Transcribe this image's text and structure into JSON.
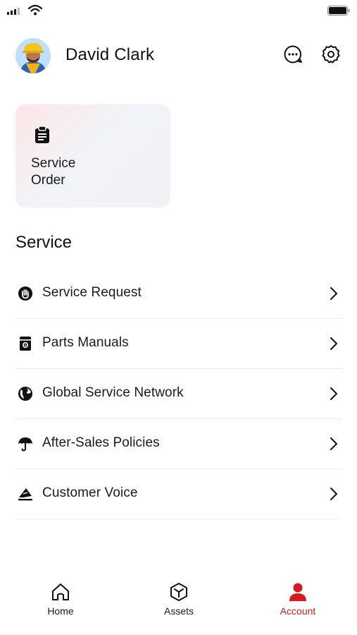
{
  "user": {
    "name": "David Clark"
  },
  "header": {
    "chat_icon": "chat-bubble-icon",
    "settings_icon": "gear-icon"
  },
  "service_order_card": {
    "label": "Service\nOrder",
    "icon": "clipboard-icon"
  },
  "section": {
    "title": "Service"
  },
  "menu": [
    {
      "label": "Service Request",
      "icon": "hand-icon"
    },
    {
      "label": "Parts Manuals",
      "icon": "manual-icon"
    },
    {
      "label": "Global Service Network",
      "icon": "globe-icon"
    },
    {
      "label": "After-Sales Policies",
      "icon": "umbrella-icon"
    },
    {
      "label": "Customer Voice",
      "icon": "voice-icon"
    }
  ],
  "tabs": [
    {
      "label": "Home",
      "icon": "home-icon",
      "active": false
    },
    {
      "label": "Assets",
      "icon": "cube-icon",
      "active": false
    },
    {
      "label": "Account",
      "icon": "user-icon",
      "active": true
    }
  ],
  "colors": {
    "accent": "#d81920",
    "text": "#1a1a1a",
    "divider": "#ececec"
  }
}
